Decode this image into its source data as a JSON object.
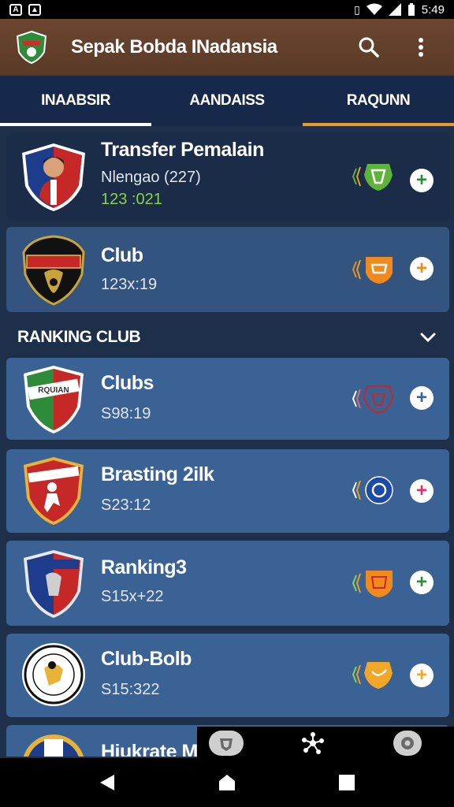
{
  "status": {
    "time": "5:49",
    "left_icons": [
      "app-icon",
      "notification-icon"
    ],
    "right_icons": [
      "vibrate-icon",
      "wifi-icon",
      "signal-icon",
      "battery-icon"
    ]
  },
  "appbar": {
    "title": "Sepak Bobda INadansia",
    "actions": [
      "search-icon",
      "overflow-menu-icon"
    ]
  },
  "tabs": [
    {
      "label": "INAABSIR"
    },
    {
      "label": "AANDAISS"
    },
    {
      "label": "RAQUNN"
    }
  ],
  "cards_top": [
    {
      "title": "Transfer Pemalain",
      "subtitle": "Nlengao (227)",
      "value": "123 :021"
    },
    {
      "title": "Club",
      "value": "123x:19"
    }
  ],
  "section": {
    "title": "RANKING CLUB"
  },
  "ranking": [
    {
      "title": "Clubs",
      "value": "S98:19"
    },
    {
      "title": "Brasting 2ilk",
      "value": "S23:12"
    },
    {
      "title": "Ranking3",
      "value": "S15x+22"
    },
    {
      "title": "Club-Bolb",
      "value": "S15:322"
    },
    {
      "title": "Hiukrate M"
    }
  ],
  "colors": {
    "appbar": "#6b4630",
    "tabs": "#17294a",
    "accent_green": "#5fb33a",
    "accent_orange": "#f08a1c",
    "accent_pink": "#e0306a",
    "accent_yellow": "#f2a728",
    "tab_indicator": "#e2a02a"
  },
  "bottom_fabs": [
    "shield-icon",
    "network-icon",
    "settings-icon"
  ],
  "nav": [
    "back-icon",
    "home-icon",
    "recents-icon"
  ]
}
